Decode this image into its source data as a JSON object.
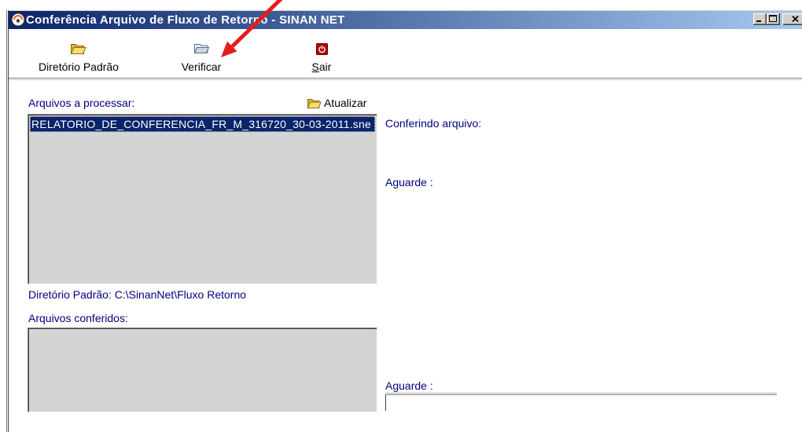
{
  "window": {
    "title": "Conferência Arquivo de Fluxo de Retorno - SINAN NET",
    "app_icon": "sinan-logo-icon",
    "controls": [
      "minimize-icon",
      "maximize-icon",
      "close-icon"
    ]
  },
  "toolbar": {
    "default_dir": {
      "label": "Diretório Padrão",
      "icon": "folder-open-icon"
    },
    "verify": {
      "label": "Verificar",
      "icon": "verify-icon"
    },
    "exit": {
      "label": "Sair",
      "icon": "power-icon"
    }
  },
  "files_panel": {
    "pending_label": "Arquivos a processar:",
    "refresh": {
      "label": "Atualizar",
      "icon": "folder-refresh-icon"
    },
    "pending_files": [
      {
        "name": "RELATORIO_DE_CONFERENCIA_FR_M_316720_30-03-2011.sne",
        "selected": true
      }
    ],
    "default_dir_text": "Diretório Padrão: C:\\SinanNet\\Fluxo Retorno",
    "checked_label": "Arquivos conferidos:",
    "checked_files": []
  },
  "status_panel": {
    "checking_label": "Conferindo arquivo:",
    "wait_label_top": "Aguarde :",
    "wait_label_bottom": "Aguarde :"
  },
  "annotation": {
    "icon": "red-arrow-icon"
  },
  "colors": {
    "title_gradient_start": "#0A246A",
    "title_gradient_end": "#A6CAF0",
    "label_text": "#000080",
    "list_background": "#D4D4D4",
    "selection_background": "#0A246A",
    "selection_text": "#FFFFFF",
    "exit_icon": "#B00000",
    "annotation_arrow": "#E41C1C"
  }
}
